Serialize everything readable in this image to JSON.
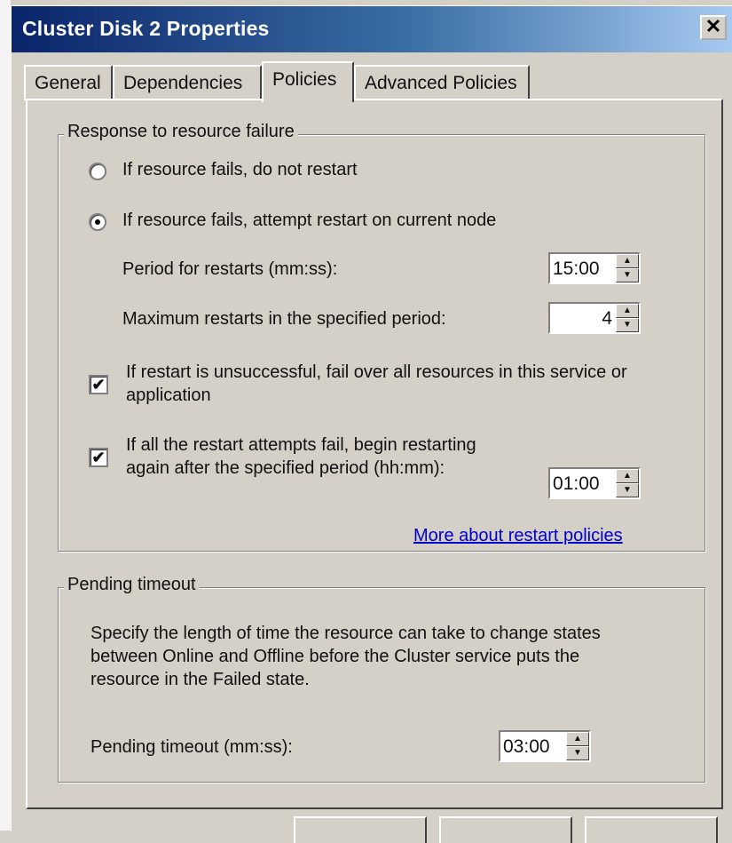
{
  "window": {
    "title": "Cluster Disk 2 Properties",
    "close_glyph": "✕"
  },
  "tabs": [
    {
      "label": "General"
    },
    {
      "label": "Dependencies"
    },
    {
      "label": "Policies",
      "active": true
    },
    {
      "label": "Advanced Policies"
    }
  ],
  "response_group": {
    "legend": "Response to resource failure",
    "radio_no_restart": {
      "label": "If resource fails, do not restart",
      "selected": false
    },
    "radio_restart": {
      "label": "If resource fails, attempt restart on current node",
      "selected": true
    },
    "period_label": "Period for restarts (mm:ss):",
    "period_value": "15:00",
    "max_restarts_label": "Maximum restarts in the specified period:",
    "max_restarts_value": "4",
    "failover_checkbox": {
      "label_line1": "If restart is unsuccessful, fail over all resources in this service or",
      "label_line2": "application",
      "checked": true
    },
    "restart_again_checkbox": {
      "label_line1": "If all the restart attempts fail, begin restarting",
      "label_line2": "again after the specified period (hh:mm):",
      "checked": true
    },
    "restart_again_value": "01:00",
    "more_link": "More about restart policies"
  },
  "pending_group": {
    "legend": "Pending timeout",
    "description_line1": "Specify the length of time the resource can take to change states",
    "description_line2": "between Online and Offline before the Cluster service puts the",
    "description_line3": "resource in the Failed state.",
    "timeout_label": "Pending timeout (mm:ss):",
    "timeout_value": "03:00"
  },
  "icons": {
    "spin_up": "▲",
    "spin_down": "▼",
    "check": "✔"
  }
}
